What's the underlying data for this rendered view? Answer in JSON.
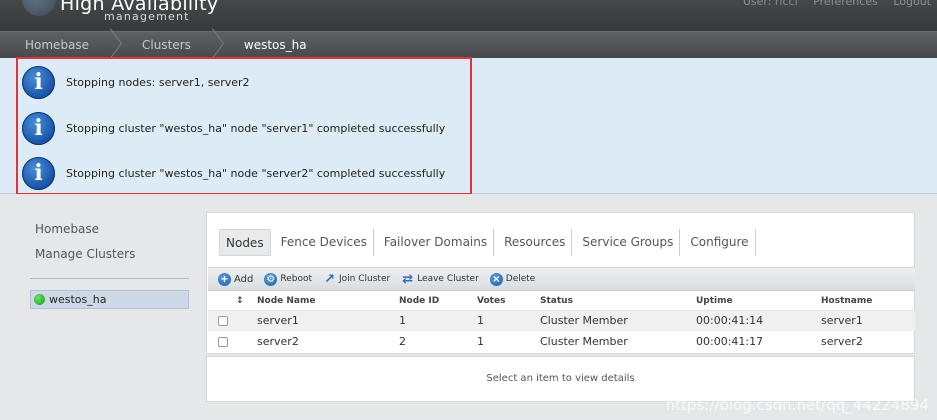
{
  "header": {
    "title": "High Availability",
    "subtitle": "management",
    "links": [
      "User: ricci",
      "Preferences",
      "Logout"
    ]
  },
  "breadcrumb": [
    "Homebase",
    "Clusters",
    "westos_ha"
  ],
  "messages": [
    "Stopping nodes: server1, server2",
    "Stopping cluster \"westos_ha\" node \"server1\" completed successfully",
    "Stopping cluster \"westos_ha\" node \"server2\" completed successfully"
  ],
  "sidebar": {
    "homebase": "Homebase",
    "manage_clusters": "Manage Clusters",
    "clusters": [
      {
        "name": "westos_ha",
        "status_color": "#13a013"
      }
    ]
  },
  "tabs": [
    "Nodes",
    "Fence Devices",
    "Failover Domains",
    "Resources",
    "Service Groups",
    "Configure"
  ],
  "active_tab": "Nodes",
  "toolbar": {
    "add": "Add",
    "reboot": "Reboot",
    "join": "Join Cluster",
    "leave": "Leave Cluster",
    "delete": "Delete"
  },
  "table": {
    "headers": [
      "Node Name",
      "Node ID",
      "Votes",
      "Status",
      "Uptime",
      "Hostname"
    ],
    "rows": [
      {
        "name": "server1",
        "id": "1",
        "votes": "1",
        "status": "Cluster Member",
        "uptime": "00:00:41:14",
        "hostname": "server1"
      },
      {
        "name": "server2",
        "id": "2",
        "votes": "1",
        "status": "Cluster Member",
        "uptime": "00:00:41:17",
        "hostname": "server2"
      }
    ]
  },
  "detail_placeholder": "Select an item to view details",
  "watermark": "https://blog.csdn.net/qq_44224894",
  "colors": {
    "error_outline": "#e0343a",
    "info_bg": "#dcebf5",
    "accent": "#1651a8"
  }
}
